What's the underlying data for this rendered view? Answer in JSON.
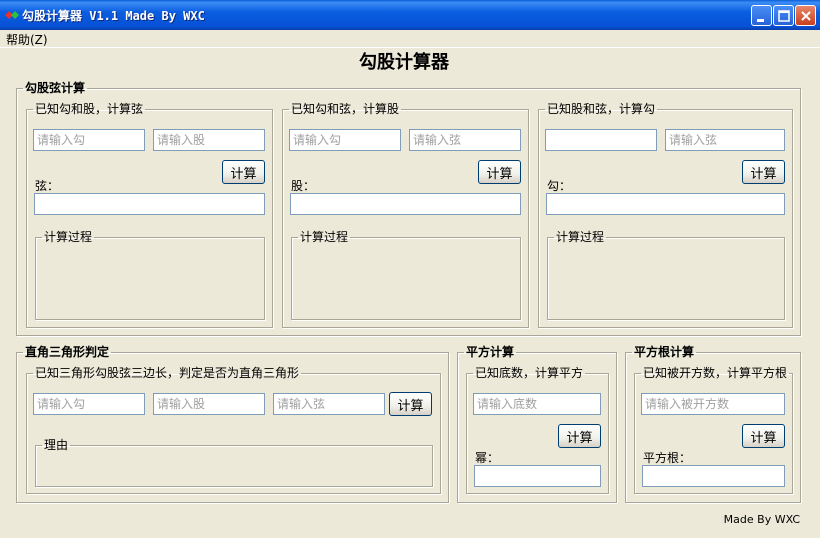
{
  "window": {
    "title": "勾股计算器 V1.1 Made By WXC"
  },
  "menu": {
    "help": "帮助(Z)"
  },
  "app_title": "勾股计算器",
  "pythag": {
    "legend": "勾股弦计算",
    "hyp": {
      "legend": "已知勾和股，计算弦",
      "a_placeholder": "请输入勾",
      "b_placeholder": "请输入股",
      "button": "计算",
      "result_label": "弦：",
      "process_legend": "计算过程"
    },
    "leg": {
      "legend": "已知勾和弦，计算股",
      "a_placeholder": "请输入勾",
      "c_placeholder": "请输入弦",
      "button": "计算",
      "result_label": "股：",
      "process_legend": "计算过程"
    },
    "base": {
      "legend": "已知股和弦，计算勾",
      "b_placeholder": "",
      "c_placeholder": "请输入弦",
      "button": "计算",
      "result_label": "勾：",
      "process_legend": "计算过程"
    }
  },
  "right_triangle": {
    "legend": "直角三角形判定",
    "inner_legend": "已知三角形勾股弦三边长，判定是否为直角三角形",
    "a_placeholder": "请输入勾",
    "b_placeholder": "请输入股",
    "c_placeholder": "请输入弦",
    "button": "计算",
    "reason_legend": "理由"
  },
  "square": {
    "legend": "平方计算",
    "inner_legend": "已知底数，计算平方",
    "base_placeholder": "请输入底数",
    "button": "计算",
    "result_label": "幂："
  },
  "sqrt": {
    "legend": "平方根计算",
    "inner_legend": "已知被开方数，计算平方根",
    "radicand_placeholder": "请输入被开方数",
    "button": "计算",
    "result_label": "平方根："
  },
  "footer": "Made By WXC"
}
